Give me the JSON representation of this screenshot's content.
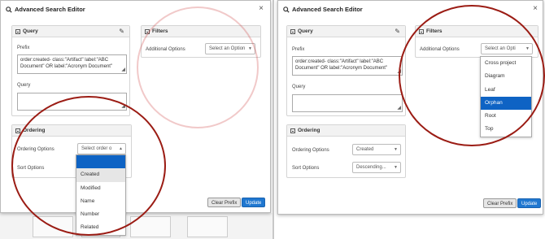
{
  "dialog": {
    "title": "Advanced Search Editor",
    "close": "×"
  },
  "query": {
    "header": "Query",
    "prefix_label": "Prefix",
    "prefix_value": "order:created- class:\"Artifact\" label:\"ABC Document\" OR label:\"Acronym Document\"",
    "query_label": "Query",
    "query_value": ""
  },
  "filters": {
    "header": "Filters",
    "additional_label": "Additional Options",
    "select_placeholder_left": "Select an Option",
    "select_placeholder_right": "Select an Opti",
    "options": [
      "Cross project",
      "Diagram",
      "Leaf",
      "Orphan",
      "Root",
      "Top"
    ],
    "active_option": "Orphan"
  },
  "ordering": {
    "header": "Ordering",
    "ordering_label": "Ordering Options",
    "sort_label": "Sort Options",
    "ordering_placeholder": "Select order o",
    "ordering_value_right": "Created",
    "sort_value_right": "Descending...",
    "options": [
      "Created",
      "Modified",
      "Name",
      "Number",
      "Related"
    ]
  },
  "buttons": {
    "clear_prefix": "Clear Prefix",
    "update": "Update"
  },
  "colors": {
    "annotation": "#9b1c14",
    "highlight": "#0e63c4",
    "primary": "#1f77d0"
  }
}
